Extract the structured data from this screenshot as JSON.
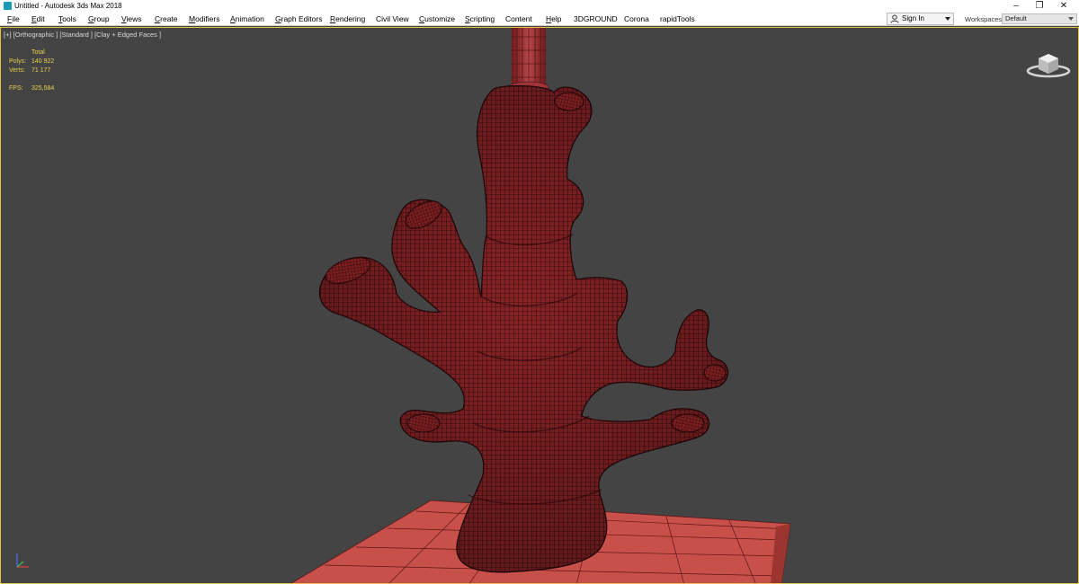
{
  "window": {
    "title": "Untitled - Autodesk 3ds Max 2018",
    "controls": {
      "minimize": "–",
      "restore": "❐",
      "close": "✕"
    }
  },
  "menu": [
    {
      "label": "File",
      "u": "F",
      "rest": "ile"
    },
    {
      "label": "Edit",
      "u": "E",
      "rest": "dit"
    },
    {
      "label": "Tools",
      "u": "T",
      "rest": "ools"
    },
    {
      "label": "Group",
      "u": "G",
      "rest": "roup"
    },
    {
      "label": "Views",
      "u": "V",
      "rest": "iews"
    },
    {
      "label": "Create",
      "u": "C",
      "rest": "reate"
    },
    {
      "label": "Modifiers",
      "u": "M",
      "rest": "odifiers"
    },
    {
      "label": "Animation",
      "u": "A",
      "rest": "nimation"
    },
    {
      "label": "Graph Editors",
      "u": "G",
      "rest": "raph Editors"
    },
    {
      "label": "Rendering",
      "u": "R",
      "rest": "endering"
    },
    {
      "label": "Civil View",
      "u": "",
      "rest": "Civil View"
    },
    {
      "label": "Customize",
      "u": "C",
      "rest": "ustomize"
    },
    {
      "label": "Scripting",
      "u": "S",
      "rest": "cripting"
    },
    {
      "label": "Content",
      "u": "",
      "rest": "Content"
    },
    {
      "label": "Help",
      "u": "H",
      "rest": "elp"
    },
    {
      "label": "3DGROUND",
      "u": "",
      "rest": "3DGROUND"
    },
    {
      "label": "Corona",
      "u": "",
      "rest": "Corona"
    },
    {
      "label": "rapidTools",
      "u": "",
      "rest": "rapidTools"
    }
  ],
  "account": {
    "signin_label": "Sign In",
    "person_icon": "person-icon"
  },
  "workspaces": {
    "label": "Workspaces:",
    "value": "Default"
  },
  "viewport": {
    "label": "[+] [Orthographic ] [Standard ] [Clay + Edged Faces ]",
    "stats": {
      "header": "Total",
      "polys_label": "Polys:",
      "polys_value": "140 922",
      "verts_label": "Verts:",
      "verts_value": "71 177",
      "fps_label": "FPS:",
      "fps_value": "325,584"
    },
    "colors": {
      "background": "#444444",
      "clay": "#8a2326",
      "wire": "#2a0a0b",
      "border": "#e0c24a",
      "stats_text": "#e3d24a"
    }
  }
}
